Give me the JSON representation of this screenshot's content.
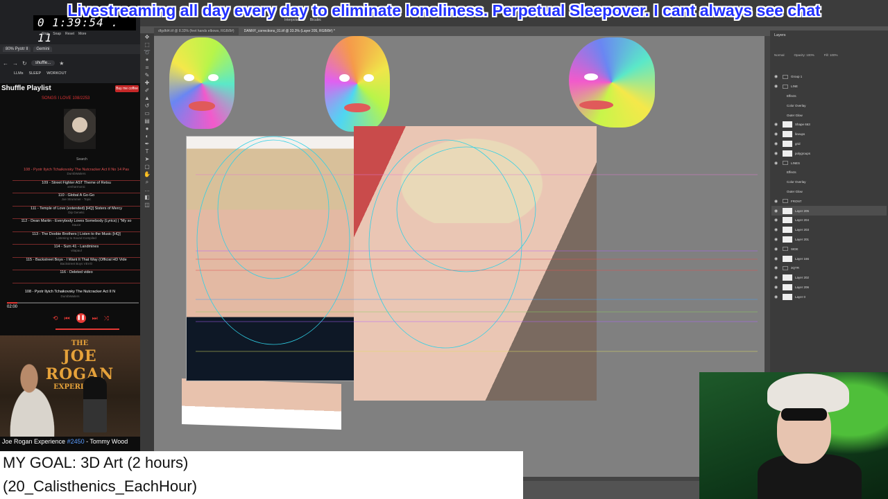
{
  "banner": {
    "text": "Livestreaming all day every day to eliminate loneliness. Perpetual Sleepover. I cant always see chat"
  },
  "clock": {
    "time": "0 1:39:54 . 11",
    "stop": "Stop",
    "snap": "Snap",
    "reset": "Reset",
    "more": "More"
  },
  "browser": {
    "tabs": [
      "80% Pyotr Il",
      "Gemini"
    ],
    "url": "shuffle...",
    "bookmarks": [
      "LLMs",
      "SLEEP",
      "WORKOUT"
    ]
  },
  "music": {
    "title": "Shuffle Playlist",
    "subscribe": "Buy me coffee",
    "songs_label": "SONGS I LOVE  108/2253",
    "search": "Search",
    "playlist": [
      {
        "t": "108 - Pyotr Ilyich Tchaikovsky The Nutcracker Act II No 14 Pas",
        "a": "DumbWaiters",
        "active": true
      },
      {
        "t": "109 - Street Fighter AST Theme of Retsu",
        "a": "xenharmonic",
        "active": false
      },
      {
        "t": "110 - Global A Go-Go",
        "a": "Joe Strummer - Topic",
        "active": false
      },
      {
        "t": "111 - Temple of Love (extended) [HQ] Sisters of Mercy",
        "a": "Dip Genetic",
        "active": false
      },
      {
        "t": "112 - Dean Martin - Everybody Loves Somebody (Lyrics) | \"My so",
        "a": "Sauce",
        "active": false
      },
      {
        "t": "113 - The Doobie Brothers | Listen to the Music [HQ]",
        "a": "Listening to Sound Compiled",
        "active": false
      },
      {
        "t": "114 - Sum 41 - Landmines",
        "a": "vitapaul",
        "active": false
      },
      {
        "t": "115 - Backstreet Boys - I Want It That Way (Official HD Vide",
        "a": "Backstreet Boys VEVO",
        "active": false
      },
      {
        "t": "116 - Deleted video",
        "a": "",
        "active": false
      }
    ],
    "now_playing": "108 - Pyotr Ilyich Tchaikovsky The Nutcracker Act II N",
    "now_artist": "DumbWaiters",
    "time": "02:00",
    "progress": 0.08
  },
  "jre": {
    "logo1": "THE",
    "logo2": "JOE ROGAN",
    "logo3": "EXPERIENCE",
    "caption_a": "Joe Rogan Experience ",
    "caption_ep": "#2450",
    "caption_b": " - Tommy Wood"
  },
  "goal": {
    "line1": "MY GOAL: 3D Art (2 hours)",
    "line2": "(20_Calisthenics_EachHour)"
  },
  "photoshop": {
    "doc_tabs": [
      "dfgdfd4.tif @ 8.33% (feet hands elbows, RGB/8#)",
      "DANNY_corrections_01.tif @ 33.3% (Layer 205, RGB/8#) *"
    ],
    "options": [
      "Interpolation:",
      "Bicubic"
    ],
    "panel_title": "Layers",
    "blend_mode": "Normal",
    "opacity": "Opacity: 100%",
    "fill": "Fill: 100%",
    "layers": [
      {
        "name": "Group 1",
        "folder": true
      },
      {
        "name": "LINE",
        "folder": true
      },
      {
        "name": "Effects",
        "folder": false,
        "sub": true
      },
      {
        "name": "Color Overlay",
        "folder": false,
        "sub": true
      },
      {
        "name": "Outer Glow",
        "folder": false,
        "sub": true
      },
      {
        "name": "Shape 663",
        "folder": false
      },
      {
        "name": "lineups",
        "folder": false
      },
      {
        "name": "grid",
        "folder": false
      },
      {
        "name": "polygroups",
        "folder": false
      },
      {
        "name": "LINES",
        "folder": true
      },
      {
        "name": "Effects",
        "folder": false,
        "sub": true
      },
      {
        "name": "Color Overlay",
        "folder": false,
        "sub": true
      },
      {
        "name": "Outer Glow",
        "folder": false,
        "sub": true
      },
      {
        "name": "FRONT",
        "folder": true
      },
      {
        "name": "Layer 205",
        "folder": false,
        "selected": true
      },
      {
        "name": "Layer 204",
        "folder": false
      },
      {
        "name": "Layer 203",
        "folder": false
      },
      {
        "name": "Layer 201",
        "folder": false
      },
      {
        "name": "SIDE",
        "folder": true
      },
      {
        "name": "Layer 166",
        "folder": false
      },
      {
        "name": "3QTR",
        "folder": true
      },
      {
        "name": "Layer 202",
        "folder": false
      },
      {
        "name": "Layer 206",
        "folder": false
      },
      {
        "name": "Layer 0",
        "folder": false
      }
    ]
  },
  "colors": {
    "banner_text": "#2130ff",
    "accent_red": "#e53935",
    "ps_bg": "#535353"
  }
}
